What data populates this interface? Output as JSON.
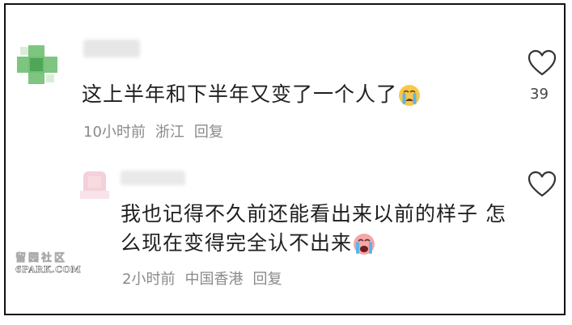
{
  "comments": [
    {
      "text": "这上半年和下半年又变了一个人了",
      "emoji_icon": "crying-face-emoji",
      "time": "10小时前",
      "location": "浙江",
      "reply_label": "回复",
      "likes": "39"
    },
    {
      "text": "我也记得不久前还能看出来以前的样子 怎么现在变得完全认不出来",
      "emoji_icon": "crying-face-emoji",
      "time": "2小时前",
      "location": "中国香港",
      "reply_label": "回复"
    }
  ],
  "watermark": {
    "title": "留园社区",
    "subtitle": "6PARK.COM"
  },
  "colors": {
    "text": "#1f1f1f",
    "meta": "#8a8a8a",
    "heart_stroke": "#333333",
    "avatar_green": "#6fbf73",
    "avatar_pink": "#f2c9d2"
  }
}
